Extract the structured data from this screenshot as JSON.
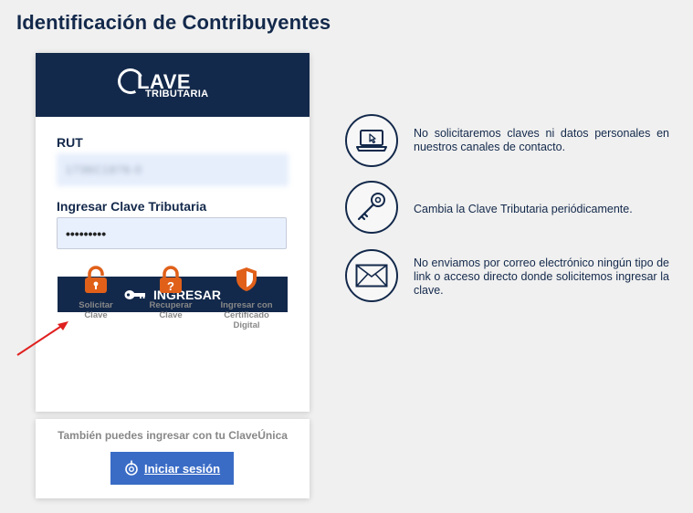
{
  "page": {
    "title": "Identificación de Contribuyentes"
  },
  "logo": {
    "main": "LAVE",
    "sub": "TRIBUTARIA"
  },
  "form": {
    "rut_label": "RUT",
    "rut_value": "1736C1876-0",
    "password_label": "Ingresar Clave Tributaria",
    "password_masked": "•••••••••",
    "submit_label": "INGRESAR"
  },
  "actions": [
    {
      "label_line1": "Solicitar",
      "label_line2": "Clave",
      "label_line3": "",
      "icon": "lock-open-icon"
    },
    {
      "label_line1": "Recuperar",
      "label_line2": "Clave",
      "label_line3": "",
      "icon": "lock-question-icon"
    },
    {
      "label_line1": "Ingresar con",
      "label_line2": "Certificado",
      "label_line3": "Digital",
      "icon": "shield-icon"
    }
  ],
  "claveunica": {
    "text": "También puedes ingresar con tu ClaveÚnica",
    "button_label": "Iniciar sesión"
  },
  "tips": [
    {
      "text": "No solicitaremos claves ni datos personales en nuestros canales de contacto.",
      "icon": "laptop-cursor-icon"
    },
    {
      "text": "Cambia la Clave Tributaria periódicamente.",
      "icon": "key-icon"
    },
    {
      "text": "No enviamos por correo electrónico ningún tipo de link o acceso directo donde solicitemos ingresar la clave.",
      "icon": "envelope-icon"
    }
  ],
  "colors": {
    "navy": "#13294b",
    "orange": "#e0601a",
    "blue_button": "#3a6cc6",
    "annotation_arrow": "#e02020"
  }
}
